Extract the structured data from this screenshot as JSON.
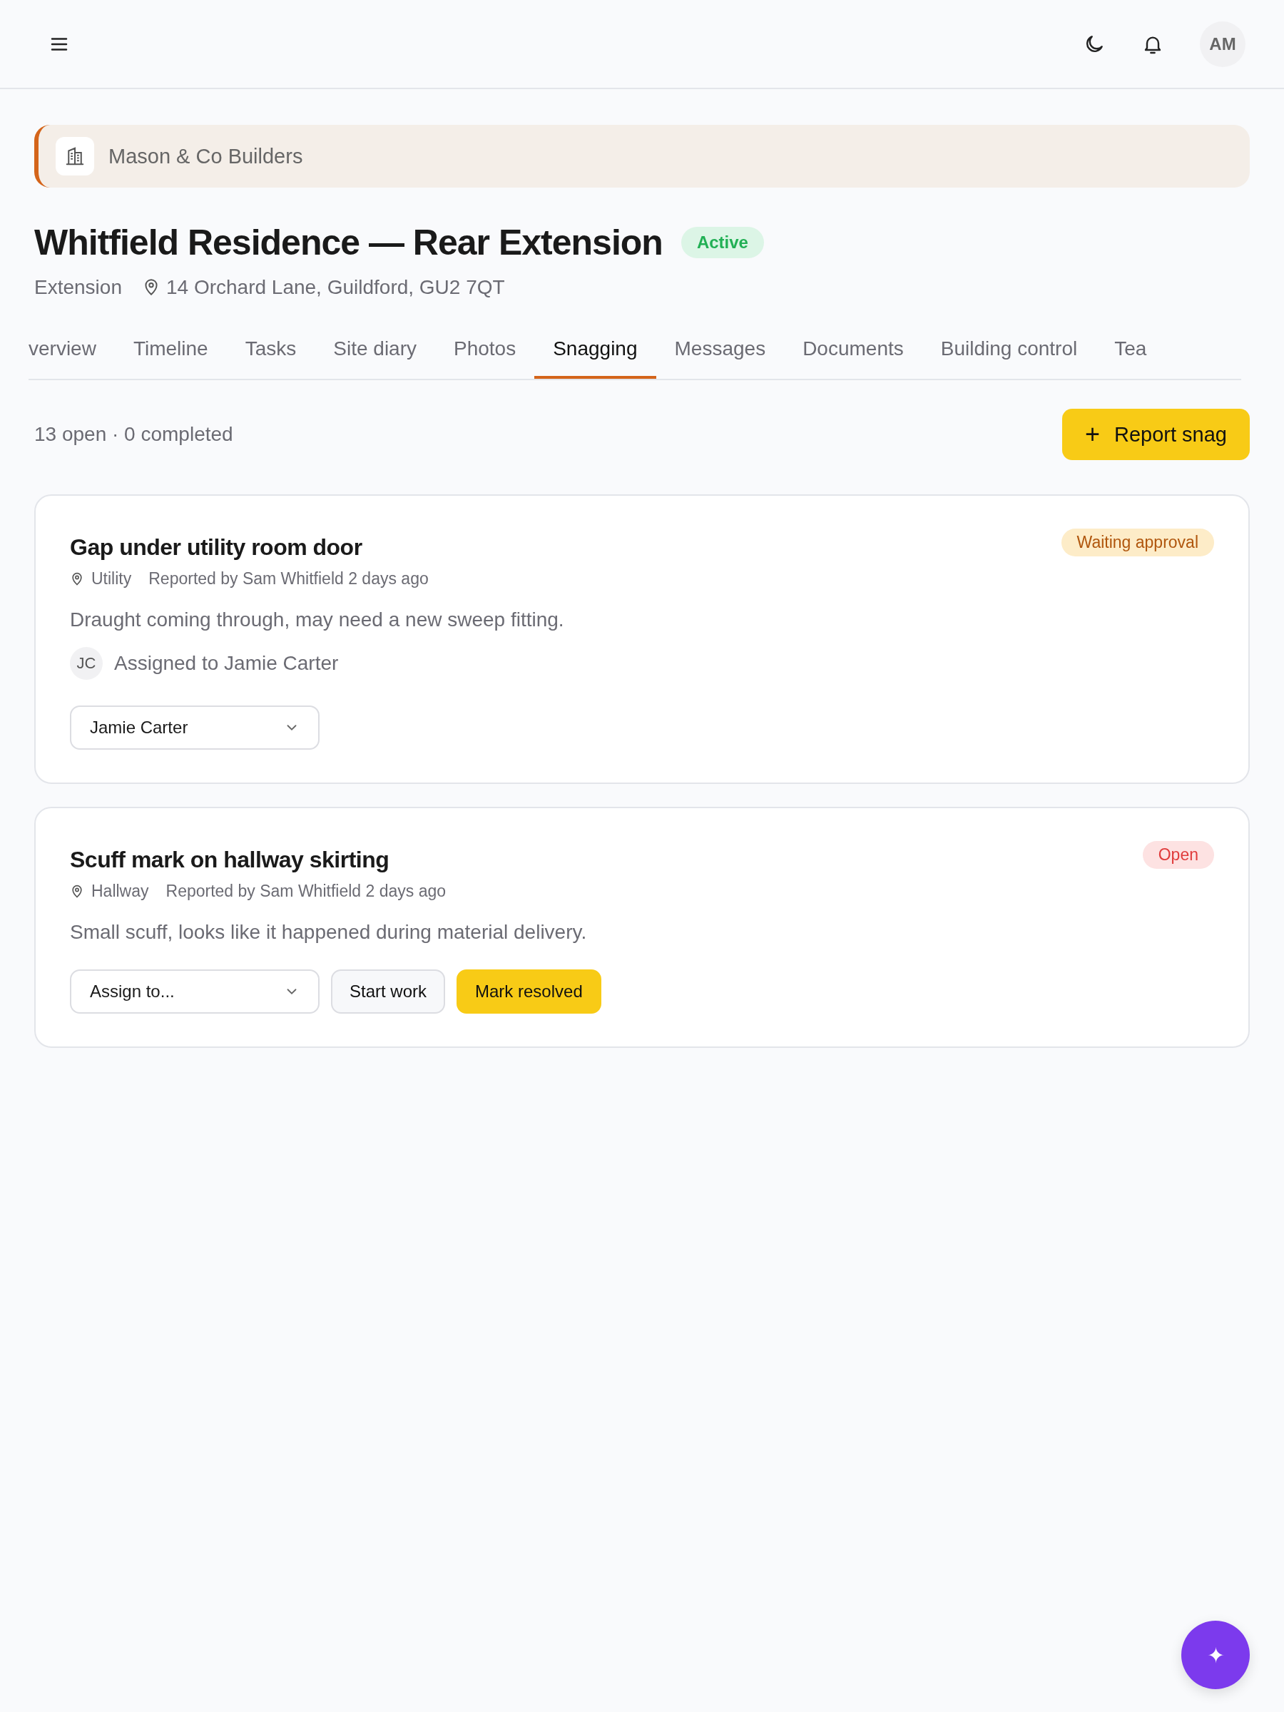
{
  "top_bar": {
    "avatar": "AM"
  },
  "company": {
    "name": "Mason & Co Builders"
  },
  "project": {
    "title": "Whitfield Residence — Rear Extension",
    "status": "Active",
    "type": "Extension",
    "address": "14 Orchard Lane, Guildford, GU2 7QT"
  },
  "tabs": [
    {
      "label": "verview",
      "selected": false
    },
    {
      "label": "Timeline",
      "selected": false
    },
    {
      "label": "Tasks",
      "selected": false
    },
    {
      "label": "Site diary",
      "selected": false
    },
    {
      "label": "Photos",
      "selected": false
    },
    {
      "label": "Snagging",
      "selected": true
    },
    {
      "label": "Messages",
      "selected": false
    },
    {
      "label": "Documents",
      "selected": false
    },
    {
      "label": "Building control",
      "selected": false
    },
    {
      "label": "Tea",
      "selected": false
    }
  ],
  "summary": "13 open · 0 completed",
  "report_button": {
    "icon": "+",
    "label": "Report snag"
  },
  "snags": [
    {
      "title": "Gap under utility room door",
      "status": {
        "label": "Waiting approval",
        "kind": "waiting"
      },
      "location": "Utility",
      "reported": "Reported by Sam Whitfield 2 days ago",
      "description": "Draught coming through, may need a new sweep fitting.",
      "assignee": {
        "initials": "JC",
        "text": "Assigned to Jamie Carter"
      },
      "actions": [
        {
          "kind": "select",
          "label": "Jamie Carter"
        }
      ]
    },
    {
      "title": "Scuff mark on hallway skirting",
      "status": {
        "label": "Open",
        "kind": "open"
      },
      "location": "Hallway",
      "reported": "Reported by Sam Whitfield 2 days ago",
      "description": "Small scuff, looks like it happened during material delivery.",
      "actions": [
        {
          "kind": "select",
          "label": "Assign to..."
        },
        {
          "kind": "button",
          "label": "Start work"
        },
        {
          "kind": "primary",
          "label": "Mark resolved"
        }
      ]
    }
  ],
  "fab": {
    "icon": "✦"
  }
}
